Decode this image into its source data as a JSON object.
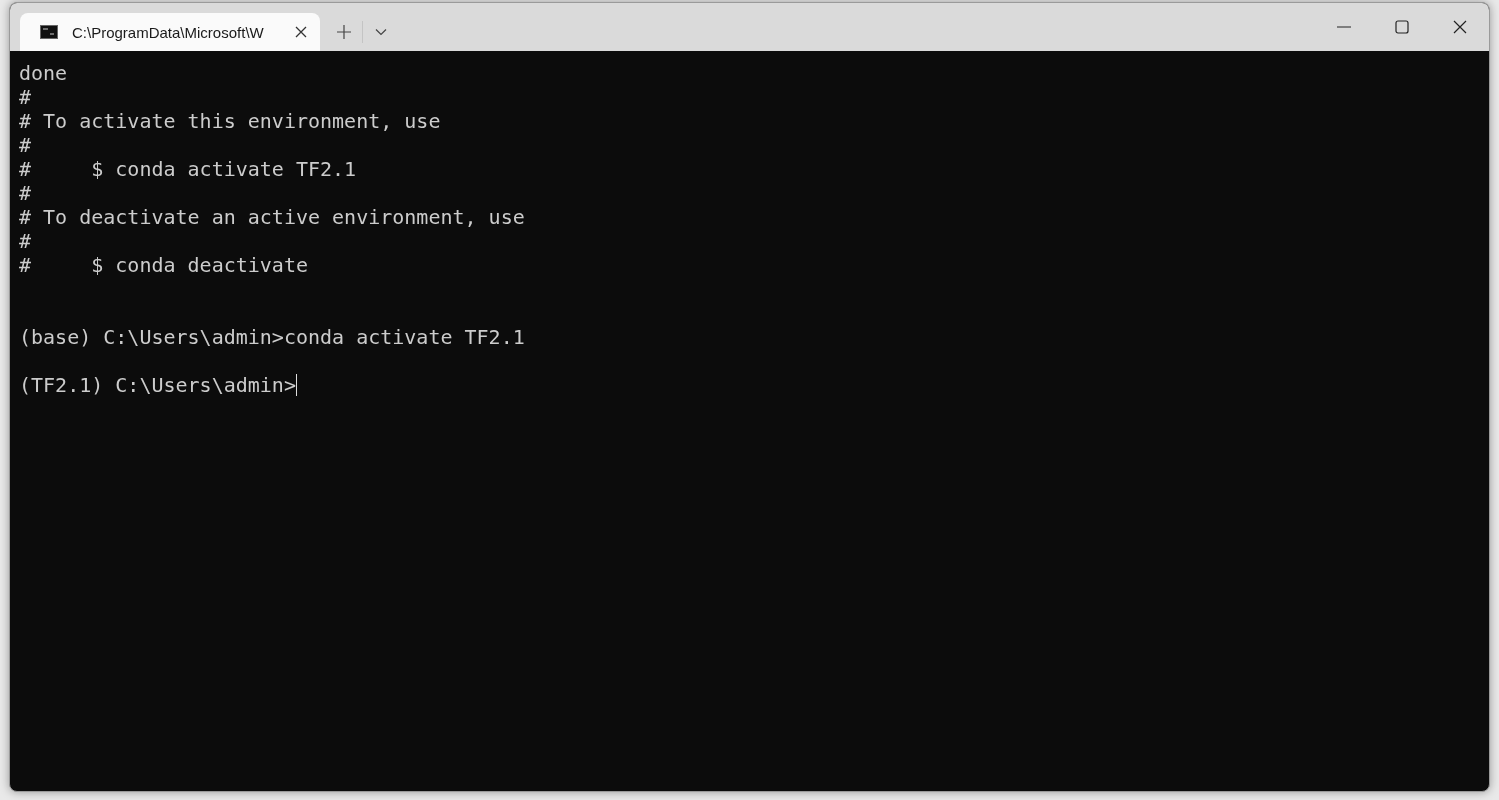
{
  "tab": {
    "title": "C:\\ProgramData\\Microsoft\\W",
    "selected": true
  },
  "terminal": {
    "lines": [
      {
        "kind": "output",
        "text": "done"
      },
      {
        "kind": "output",
        "text": "#"
      },
      {
        "kind": "output",
        "text": "# To activate this environment, use"
      },
      {
        "kind": "output",
        "text": "#"
      },
      {
        "kind": "output",
        "text": "#     $ conda activate TF2.1"
      },
      {
        "kind": "output",
        "text": "#"
      },
      {
        "kind": "output",
        "text": "# To deactivate an active environment, use"
      },
      {
        "kind": "output",
        "text": "#"
      },
      {
        "kind": "output",
        "text": "#     $ conda deactivate"
      },
      {
        "kind": "prompt",
        "text": "(base) C:\\Users\\admin>conda activate TF2.1",
        "cursor": false
      },
      {
        "kind": "prompt",
        "text": "(TF2.1) C:\\Users\\admin>",
        "cursor": true
      }
    ]
  }
}
